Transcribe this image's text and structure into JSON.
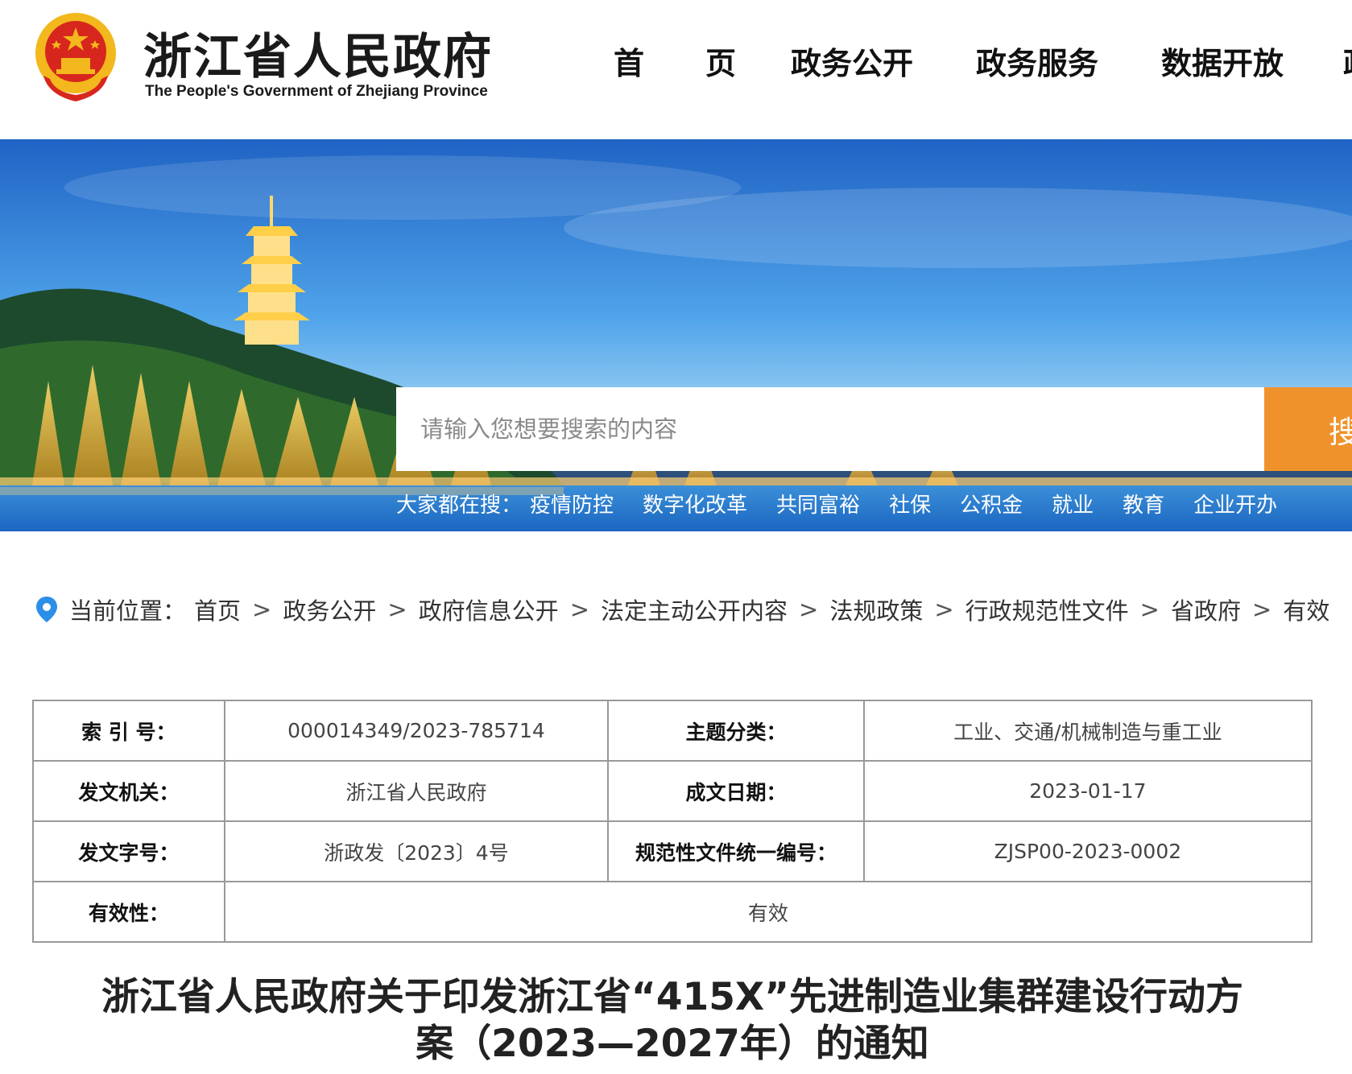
{
  "header": {
    "title_cn": "浙江省人民政府",
    "title_en": "The People's Government of Zhejiang Province",
    "nav": [
      "首　　页",
      "政务公开",
      "政务服务",
      "数据开放",
      "政"
    ]
  },
  "search": {
    "placeholder": "请输入您想要搜索的内容",
    "button": "搜",
    "hot_label": "大家都在搜：",
    "hot_links": [
      "疫情防控",
      "数字化改革",
      "共同富裕",
      "社保",
      "公积金",
      "就业",
      "教育",
      "企业开办"
    ]
  },
  "breadcrumb": {
    "label": "当前位置：",
    "items": [
      "首页",
      "政务公开",
      "政府信息公开",
      "法定主动公开内容",
      "法规政策",
      "行政规范性文件",
      "省政府",
      "有效"
    ],
    "separator": ">"
  },
  "meta": {
    "index_label": "索 引 号：",
    "index_value": "000014349/2023-785714",
    "topic_label": "主题分类：",
    "topic_value": "工业、交通/机械制造与重工业",
    "issuer_label": "发文机关：",
    "issuer_value": "浙江省人民政府",
    "date_label": "成文日期：",
    "date_value": "2023-01-17",
    "docno_label": "发文字号：",
    "docno_value": "浙政发〔2023〕4号",
    "code_label": "规范性文件统一编号：",
    "code_value": "ZJSP00-2023-0002",
    "validity_label": "有效性：",
    "validity_value": "有效"
  },
  "document": {
    "title_line1": "浙江省人民政府关于印发浙江省“415X”先进制造业集群建设行动方",
    "title_line2": "案（2023—2027年）的通知"
  },
  "colors": {
    "accent": "#f0922b",
    "breadcrumb_pin": "#2b8fe8",
    "emblem_red": "#d7261e",
    "emblem_gold": "#f2b81d"
  }
}
